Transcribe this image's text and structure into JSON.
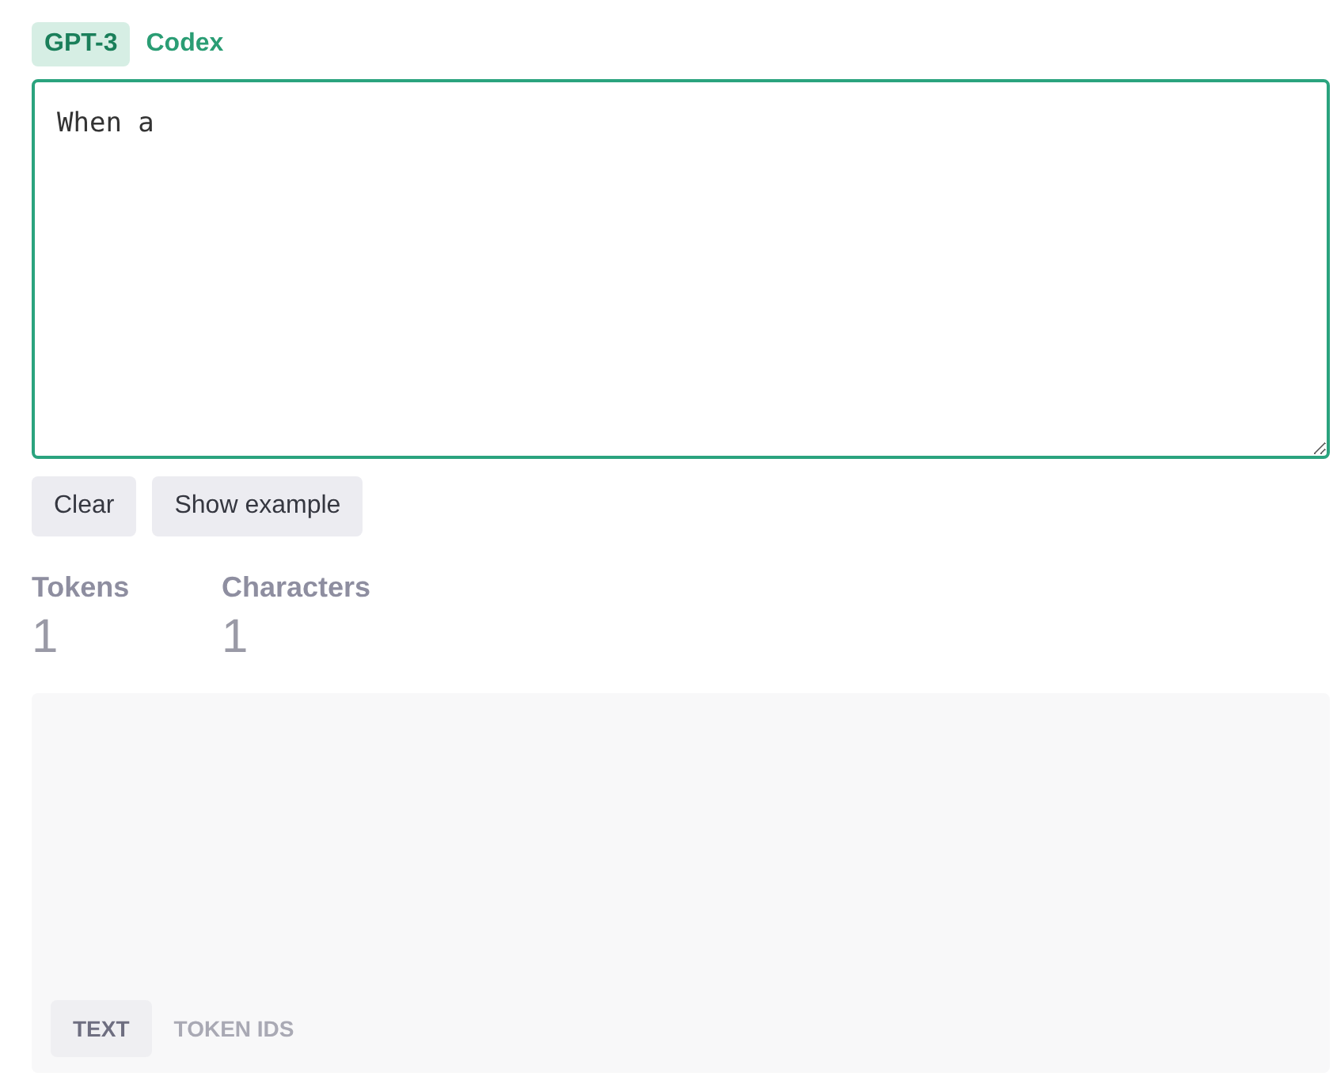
{
  "model_tabs": [
    {
      "label": "GPT-3",
      "selected": true
    },
    {
      "label": "Codex",
      "selected": false
    }
  ],
  "prompt": {
    "value": "When a "
  },
  "buttons": [
    "Clear",
    "Show example"
  ],
  "stats": [
    {
      "label": "Tokens",
      "value": "1"
    },
    {
      "label": "Characters",
      "value": "1"
    }
  ],
  "view_tabs": [
    {
      "label": "TEXT",
      "selected": true
    },
    {
      "label": "TOKEN IDS",
      "selected": false
    }
  ]
}
